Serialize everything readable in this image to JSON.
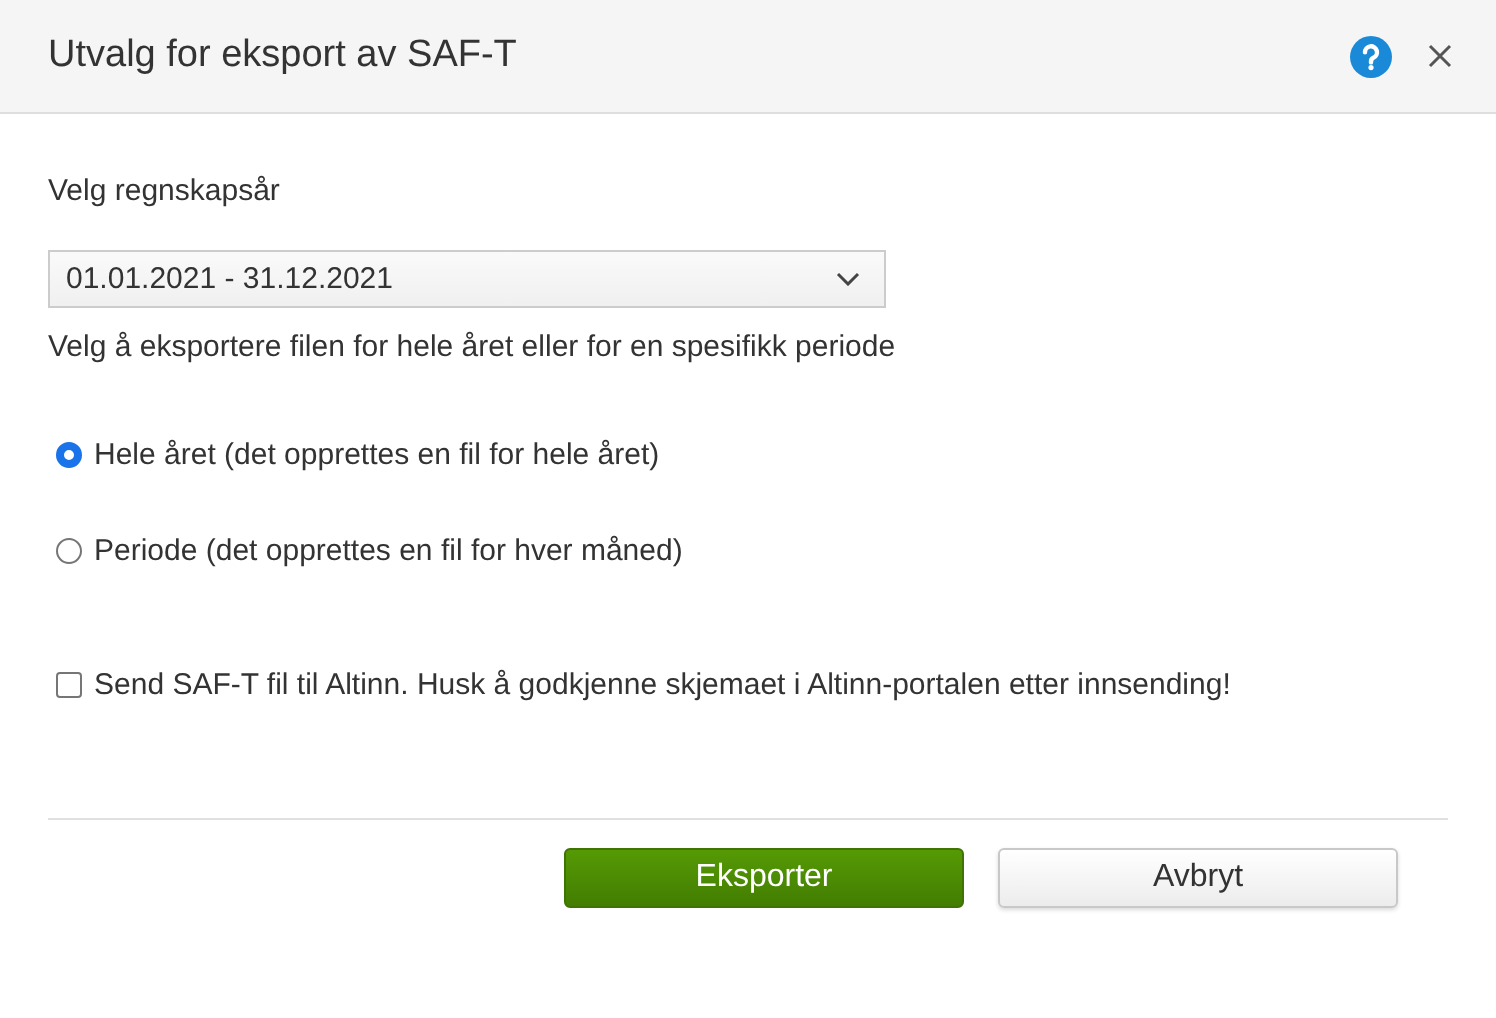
{
  "dialog": {
    "title": "Utvalg for eksport av SAF-T"
  },
  "year_field": {
    "label": "Velg regnskapsår",
    "value": "01.01.2021 - 31.12.2021",
    "hint": "Velg å eksportere filen for hele året eller for en spesifikk periode"
  },
  "options": [
    {
      "label": "Hele året (det opprettes en fil for hele året)",
      "selected": true
    },
    {
      "label": "Periode (det opprettes en fil for hver måned)",
      "selected": false
    }
  ],
  "altinn": {
    "label": "Send SAF-T fil til Altinn. Husk å godkjenne skjemaet i Altinn-portalen etter innsending!",
    "checked": false
  },
  "buttons": [
    {
      "label": "Eksporter",
      "kind": "primary"
    },
    {
      "label": "Avbryt",
      "kind": "secondary"
    }
  ]
}
